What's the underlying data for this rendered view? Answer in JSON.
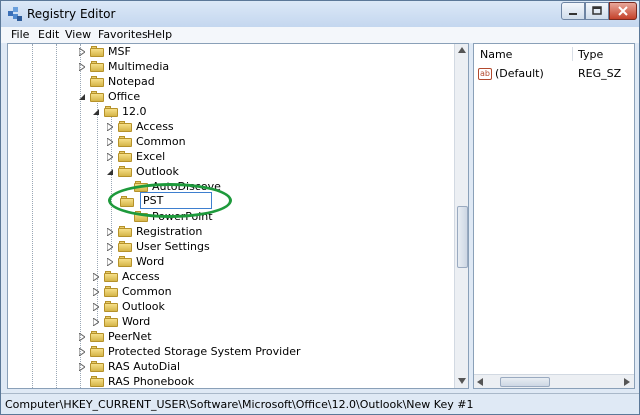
{
  "window": {
    "title": "Registry Editor"
  },
  "menubar": {
    "items": [
      "File",
      "Edit",
      "View",
      "Favorites",
      "Help"
    ]
  },
  "tree": {
    "items": [
      {
        "label": "MSF",
        "expanded": false
      },
      {
        "label": "Multimedia",
        "expanded": false
      },
      {
        "label": "Notepad",
        "expanded": false
      },
      {
        "label": "Office",
        "expanded": true
      },
      {
        "label": "12.0",
        "expanded": true
      },
      {
        "label": "Access",
        "expanded": false
      },
      {
        "label": "Common",
        "expanded": false
      },
      {
        "label": "Excel",
        "expanded": false
      },
      {
        "label": "Outlook",
        "expanded": true
      },
      {
        "label": "AutoDiscove",
        "expanded": false
      },
      {
        "label": "PST",
        "expanded": false,
        "editing": true
      },
      {
        "label": "PowerPoint",
        "expanded": false
      },
      {
        "label": "Registration",
        "expanded": false
      },
      {
        "label": "User Settings",
        "expanded": false
      },
      {
        "label": "Word",
        "expanded": false
      },
      {
        "label": "Access",
        "expanded": false
      },
      {
        "label": "Common",
        "expanded": false
      },
      {
        "label": "Outlook",
        "expanded": false
      },
      {
        "label": "Word",
        "expanded": false
      },
      {
        "label": "PeerNet",
        "expanded": false
      },
      {
        "label": "Protected Storage System Provider",
        "expanded": false
      },
      {
        "label": "RAS AutoDial",
        "expanded": false
      },
      {
        "label": "RAS Phonebook",
        "expanded": false
      }
    ]
  },
  "values_pane": {
    "columns": [
      "Name",
      "Type"
    ],
    "rows": [
      {
        "name": "(Default)",
        "type": "REG_SZ"
      }
    ]
  },
  "statusbar": {
    "path": "Computer\\HKEY_CURRENT_USER\\Software\\Microsoft\\Office\\12.0\\Outlook\\New Key #1"
  },
  "colors": {
    "highlight": "#1e9a3c",
    "folder": "#e8cc6b"
  }
}
